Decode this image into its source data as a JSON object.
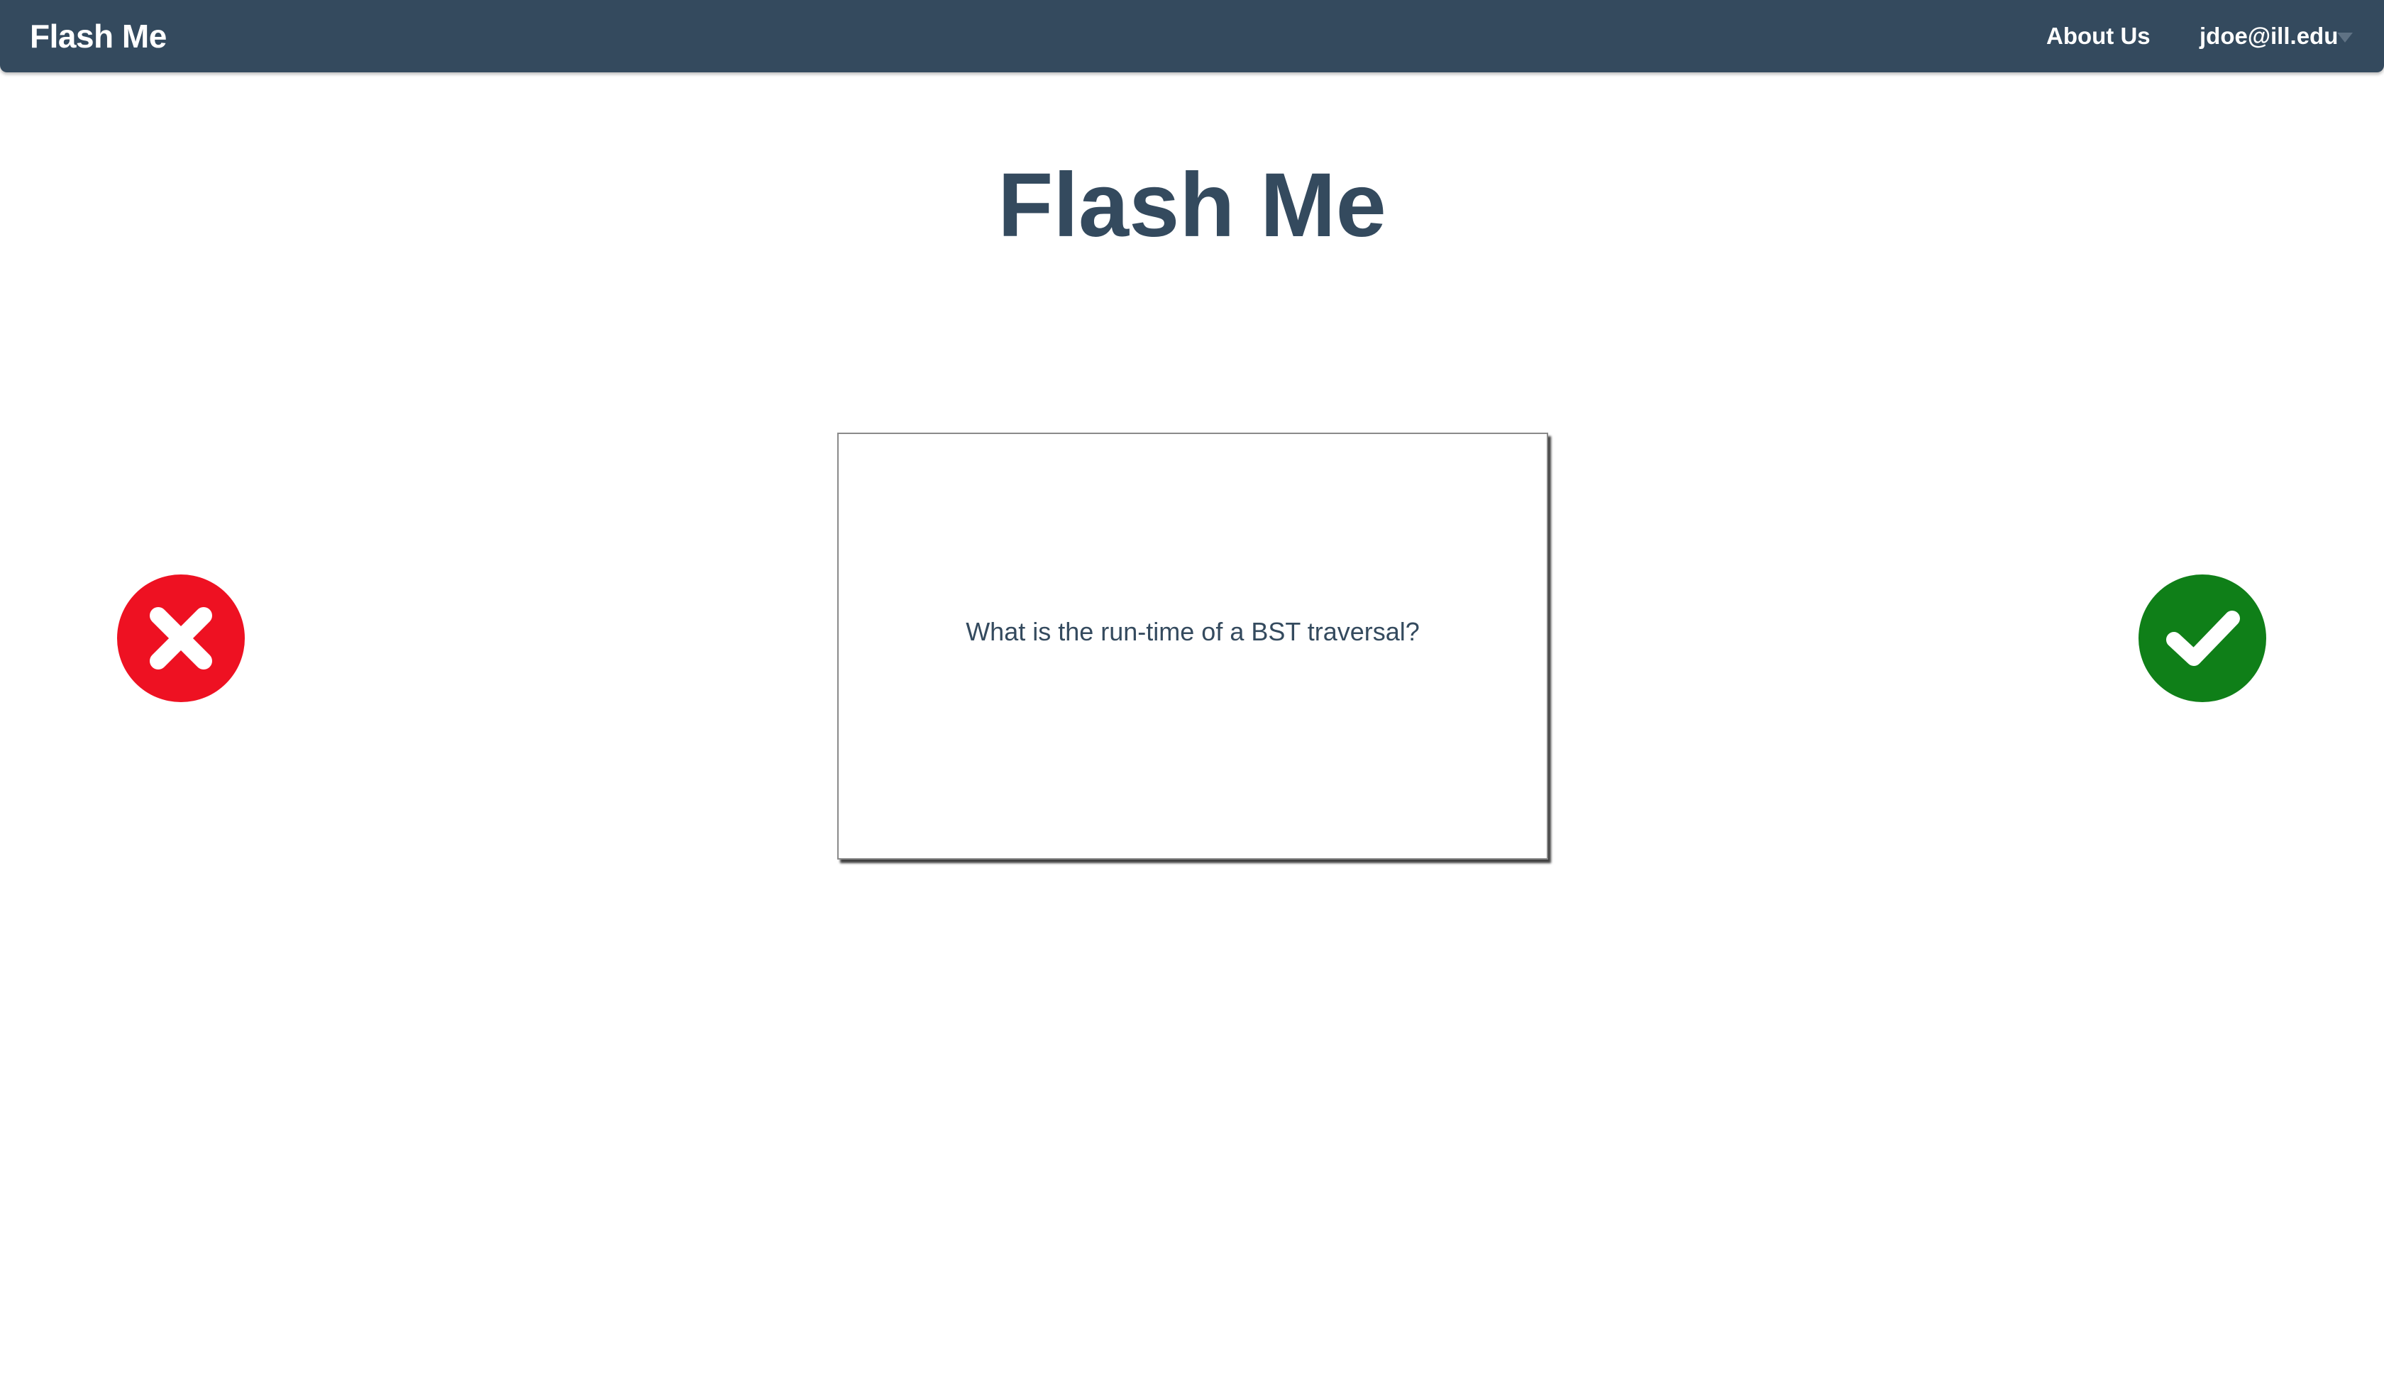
{
  "navbar": {
    "brand": "Flash Me",
    "about_link": "About Us",
    "user_email": "jdoe@ill.edu",
    "background_color": "#344a5e"
  },
  "main": {
    "title": "Flash Me"
  },
  "card": {
    "question": "What is the run-time of a BST traversal?"
  },
  "actions": {
    "wrong": {
      "icon": "x-mark-icon",
      "color": "#ee1122"
    },
    "right": {
      "icon": "check-mark-icon",
      "color": "#0f7f18"
    }
  }
}
